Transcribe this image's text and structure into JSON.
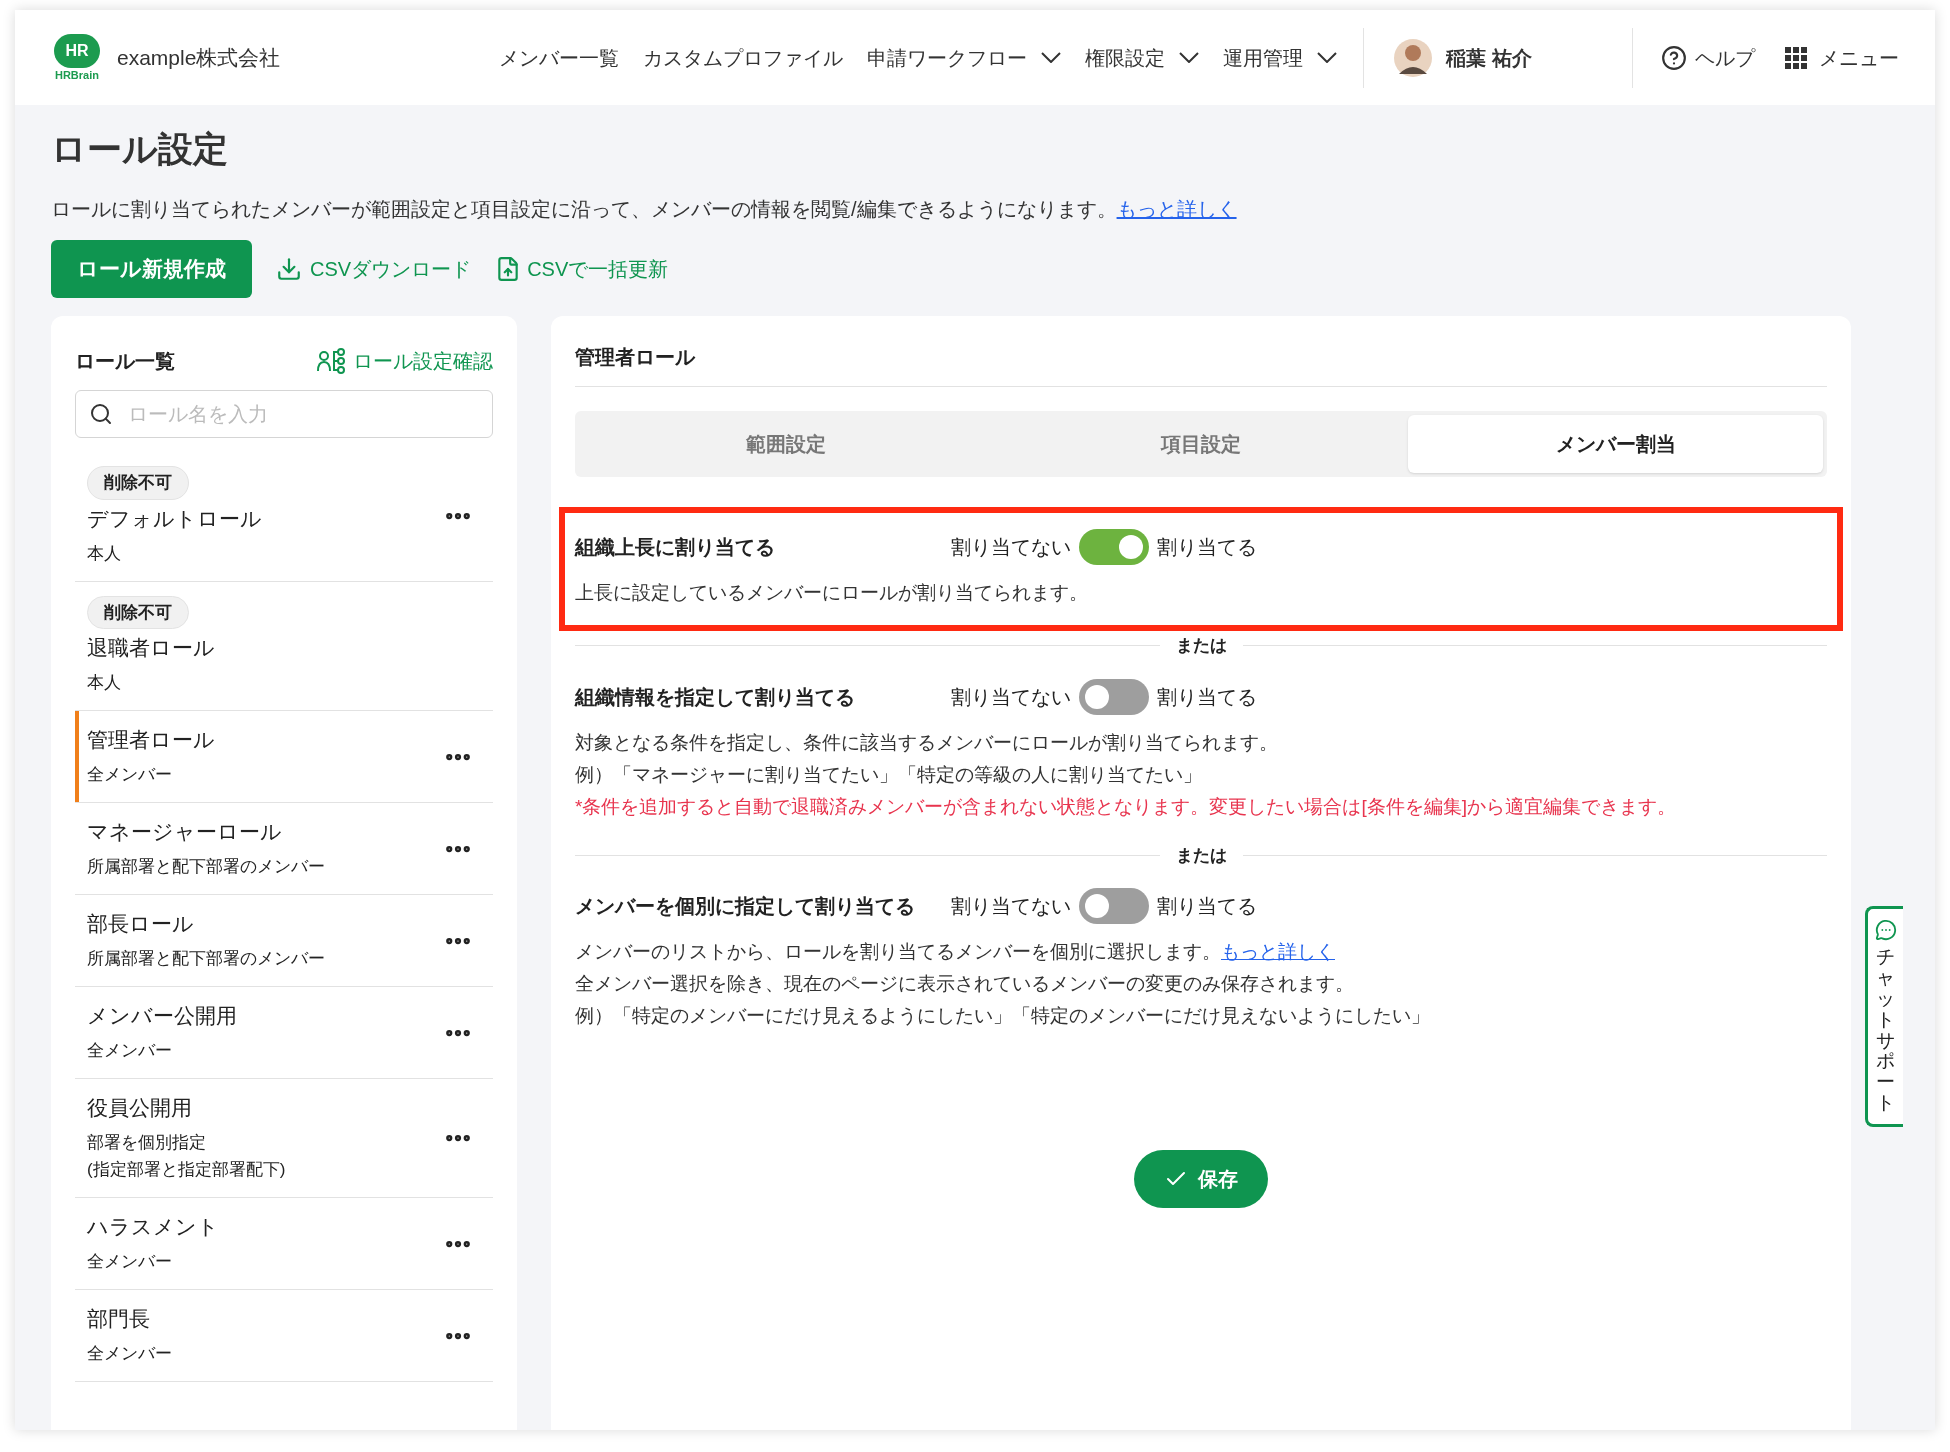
{
  "header": {
    "logo": {
      "badge": "HR",
      "wordmark": "HRBrain"
    },
    "company": "example株式会社",
    "nav": [
      {
        "label": "メンバー一覧",
        "dropdown": false
      },
      {
        "label": "カスタムプロファイル",
        "dropdown": false
      },
      {
        "label": "申請ワークフロー",
        "dropdown": true
      },
      {
        "label": "権限設定",
        "dropdown": true
      },
      {
        "label": "運用管理",
        "dropdown": true
      }
    ],
    "user": "稲葉 祐介",
    "help": "ヘルプ",
    "menu": "メニュー"
  },
  "title": "ロール設定",
  "description": {
    "text": "ロールに割り当てられたメンバーが範囲設定と項目設定に沿って、メンバーの情報を閲覧/編集できるようになります。",
    "link": "もっと詳しく"
  },
  "actions": [
    {
      "kind": "primary",
      "label": "ロール新規作成"
    },
    {
      "kind": "download",
      "label": "CSVダウンロード"
    },
    {
      "kind": "upload",
      "label": "CSVで一括更新"
    }
  ],
  "role_list": {
    "title": "ロール一覧",
    "check_link": "ロール設定確認",
    "search_placeholder": "ロール名を入力",
    "items": [
      {
        "badge": "削除不可",
        "name": "デフォルトロール",
        "scope": [
          "本人"
        ],
        "menu": true,
        "selected": false
      },
      {
        "badge": "削除不可",
        "name": "退職者ロール",
        "scope": [
          "本人"
        ],
        "menu": false,
        "selected": false
      },
      {
        "name": "管理者ロール",
        "scope": [
          "全メンバー"
        ],
        "menu": true,
        "selected": true
      },
      {
        "name": "マネージャーロール",
        "scope": [
          "所属部署と配下部署のメンバー"
        ],
        "menu": true,
        "selected": false
      },
      {
        "name": "部長ロール",
        "scope": [
          "所属部署と配下部署のメンバー"
        ],
        "menu": true,
        "selected": false
      },
      {
        "name": "メンバー公開用",
        "scope": [
          "全メンバー"
        ],
        "menu": true,
        "selected": false
      },
      {
        "name": "役員公開用",
        "scope": [
          "部署を個別指定",
          "(指定部署と指定部署配下)"
        ],
        "menu": true,
        "selected": false
      },
      {
        "name": "ハラスメント",
        "scope": [
          "全メンバー"
        ],
        "menu": true,
        "selected": false
      },
      {
        "name": "部門長",
        "scope": [
          "全メンバー"
        ],
        "menu": true,
        "selected": false
      }
    ]
  },
  "detail": {
    "title": "管理者ロール",
    "tabs": [
      {
        "label": "範囲設定",
        "selected": false
      },
      {
        "label": "項目設定",
        "selected": false
      },
      {
        "label": "メンバー割当",
        "selected": true
      }
    ],
    "options": [
      {
        "title": "組織上長に割り当てる",
        "off_label": "割り当てない",
        "on_label": "割り当てる",
        "on": true,
        "highlighted": true,
        "lines": [
          {
            "kind": "normal",
            "text": "上長に設定しているメンバーにロールが割り当てられます。"
          }
        ]
      },
      {
        "separator": "または",
        "title": "組織情報を指定して割り当てる",
        "off_label": "割り当てない",
        "on_label": "割り当てる",
        "on": false,
        "highlighted": false,
        "lines": [
          {
            "kind": "normal",
            "text": "対象となる条件を指定し、条件に該当するメンバーにロールが割り当てられます。"
          },
          {
            "kind": "normal",
            "text": "例）「マネージャーに割り当てたい」「特定の等級の人に割り当てたい」"
          },
          {
            "kind": "warning",
            "text": "*条件を追加すると自動で退職済みメンバーが含まれない状態となります。変更したい場合は[条件を編集]から適宜編集できます。"
          }
        ]
      },
      {
        "separator": "または",
        "title": "メンバーを個別に指定して割り当てる",
        "off_label": "割り当てない",
        "on_label": "割り当てる",
        "on": false,
        "highlighted": false,
        "lines": [
          {
            "kind": "normal",
            "text": "メンバーのリストから、ロールを割り当てるメンバーを個別に選択します。",
            "link": "もっと詳しく"
          },
          {
            "kind": "normal",
            "text": "全メンバー選択を除き、現在のページに表示されているメンバーの変更のみ保存されます。"
          },
          {
            "kind": "normal",
            "text": "例）「特定のメンバーにだけ見えるようにしたい」「特定のメンバーにだけ見えないようにしたい」"
          }
        ]
      }
    ],
    "save": "保存"
  },
  "chat_support": "チャットサポート"
}
